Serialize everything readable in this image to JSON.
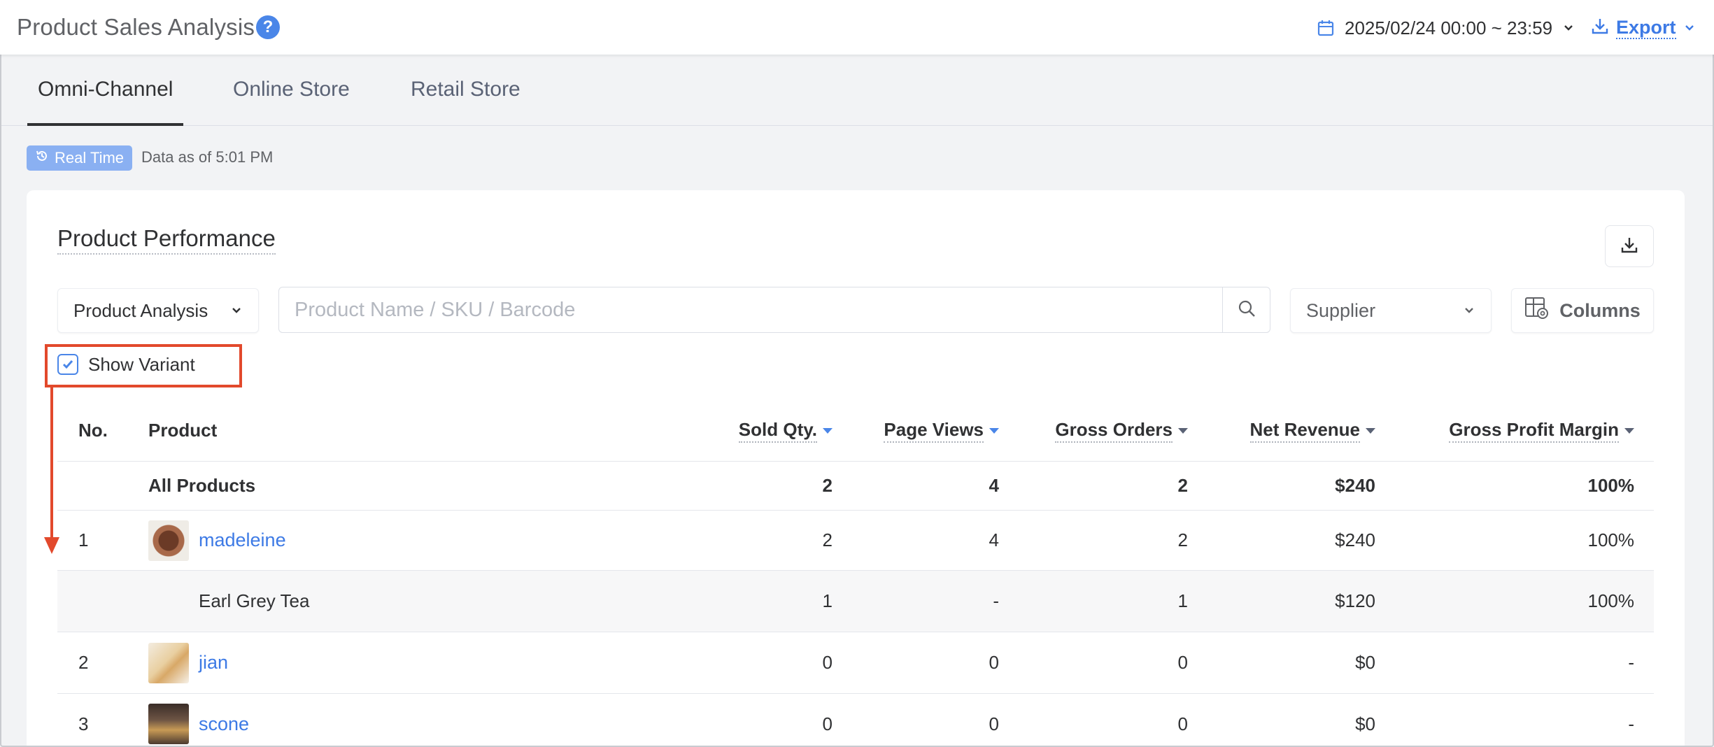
{
  "header": {
    "title": "Product Sales Analysis",
    "date_range": "2025/02/24 00:00 ~ 23:59",
    "export_label": "Export"
  },
  "tabs": [
    {
      "label": "Omni-Channel",
      "active": true
    },
    {
      "label": "Online Store",
      "active": false
    },
    {
      "label": "Retail Store",
      "active": false
    }
  ],
  "realtime": {
    "badge": "Real Time",
    "data_as_of": "Data as of 5:01 PM"
  },
  "card": {
    "title": "Product Performance",
    "analysis_select": "Product Analysis",
    "search_placeholder": "Product Name / SKU / Barcode",
    "supplier_placeholder": "Supplier",
    "columns_label": "Columns",
    "show_variant_label": "Show Variant",
    "show_variant_checked": true
  },
  "table": {
    "headers": {
      "no": "No.",
      "product": "Product",
      "sold_qty": "Sold Qty.",
      "page_views": "Page Views",
      "gross_orders": "Gross Orders",
      "net_revenue": "Net Revenue",
      "gross_profit_margin": "Gross Profit Margin"
    },
    "total": {
      "label": "All Products",
      "sold_qty": "2",
      "page_views": "4",
      "gross_orders": "2",
      "net_revenue": "$240",
      "gross_profit_margin": "100%"
    },
    "rows": [
      {
        "no": "1",
        "name": "madeleine",
        "sold_qty": "2",
        "page_views": "4",
        "gross_orders": "2",
        "net_revenue": "$240",
        "gross_profit_margin": "100%"
      },
      {
        "variant": "Earl Grey Tea",
        "sold_qty": "1",
        "page_views": "-",
        "gross_orders": "1",
        "net_revenue": "$120",
        "gross_profit_margin": "100%"
      },
      {
        "no": "2",
        "name": "jian",
        "sold_qty": "0",
        "page_views": "0",
        "gross_orders": "0",
        "net_revenue": "$0",
        "gross_profit_margin": "-"
      },
      {
        "no": "3",
        "name": "scone",
        "sold_qty": "0",
        "page_views": "0",
        "gross_orders": "0",
        "net_revenue": "$0",
        "gross_profit_margin": "-"
      }
    ]
  },
  "colors": {
    "accent": "#3d7ae5",
    "realtime_badge": "#8ab0f2",
    "annotation": "#e2492c"
  }
}
